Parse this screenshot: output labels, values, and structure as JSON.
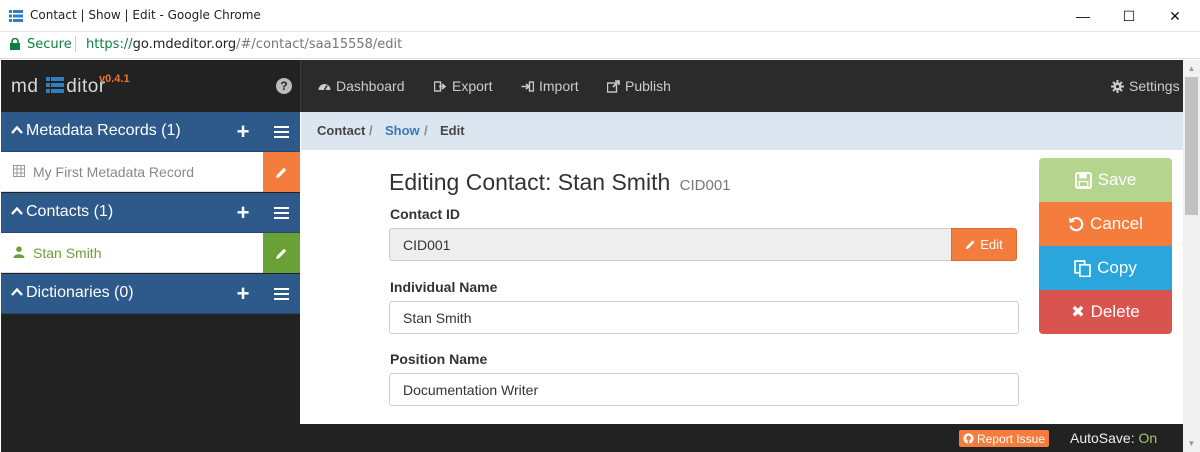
{
  "window": {
    "title": "Contact | Show | Edit - Google Chrome",
    "app_icon": "mdeditor-favicon",
    "minimize_glyph": "—",
    "maximize_glyph": "☐",
    "close_glyph": "✕"
  },
  "address_bar": {
    "secure_label": "Secure",
    "url_scheme": "https://",
    "url_host": "go.mdeditor.org",
    "url_path": "/#/contact/saa15558/edit"
  },
  "brand": {
    "prefix": "md",
    "suffix": "ditor",
    "version": "v0.4.1",
    "help_icon": "question-circle-icon",
    "help_glyph": "?"
  },
  "sidebar": {
    "metadata_records": {
      "header": "Metadata Records (1)",
      "items": [
        {
          "label": "My First Metadata Record",
          "icon": "table-icon"
        }
      ]
    },
    "contacts": {
      "header": "Contacts (1)",
      "items": [
        {
          "label": "Stan Smith",
          "icon": "user-icon"
        }
      ]
    },
    "dictionaries": {
      "header": "Dictionaries (0)"
    },
    "add_glyph": "+"
  },
  "nav": {
    "dashboard": "Dashboard",
    "export": "Export",
    "import": "Import",
    "publish": "Publish",
    "settings": "Settings"
  },
  "breadcrumb": {
    "items": [
      "Contact",
      "Show",
      "Edit"
    ],
    "separator": "/"
  },
  "form": {
    "title": "Editing Contact: Stan Smith",
    "title_id": "CID001",
    "contact_id_label": "Contact ID",
    "contact_id_value": "CID001",
    "contact_id_edit": "Edit",
    "individual_name_label": "Individual Name",
    "individual_name_value": "Stan Smith",
    "position_name_label": "Position Name",
    "position_name_value": "Documentation Writer"
  },
  "actions": {
    "save": "Save",
    "cancel": "Cancel",
    "copy": "Copy",
    "delete": "Delete",
    "delete_glyph": "✖"
  },
  "footer": {
    "report_issue": "Report Issue",
    "autosave_label": "AutoSave:",
    "autosave_state": "On"
  },
  "colors": {
    "sidebar_header": "#2d5a8a",
    "accent_orange": "#f47c3c",
    "contact_green": "#6aa136",
    "save_green": "#b5d58f",
    "copy_blue": "#2aa6dd",
    "delete_red": "#d9534f",
    "autosave_on": "#9ccc65"
  }
}
